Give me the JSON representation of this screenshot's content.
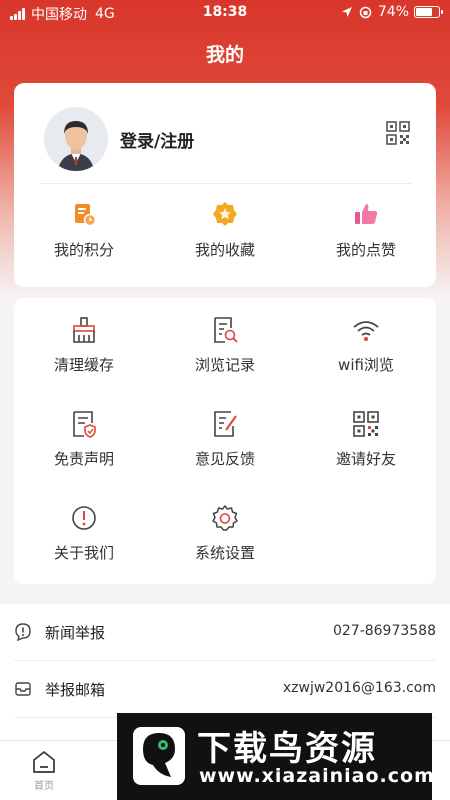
{
  "status_bar": {
    "carrier": "中国移动",
    "network": "4G",
    "time": "18:38",
    "battery": "74%",
    "battery_level": 0.74
  },
  "page": {
    "title": "我的"
  },
  "profile": {
    "login_label": "登录/注册"
  },
  "stats": [
    {
      "label": "我的积分",
      "icon": "points-icon"
    },
    {
      "label": "我的收藏",
      "icon": "star-icon"
    },
    {
      "label": "我的点赞",
      "icon": "thumbs-up-icon"
    }
  ],
  "tools": [
    {
      "label": "清理缓存",
      "icon": "broom-icon"
    },
    {
      "label": "浏览记录",
      "icon": "history-icon"
    },
    {
      "label": "wifi浏览",
      "icon": "wifi-icon"
    },
    {
      "label": "免责声明",
      "icon": "disclaimer-icon"
    },
    {
      "label": "意见反馈",
      "icon": "feedback-icon"
    },
    {
      "label": "邀请好友",
      "icon": "qr-code-icon"
    },
    {
      "label": "关于我们",
      "icon": "info-icon"
    },
    {
      "label": "系统设置",
      "icon": "gear-icon"
    }
  ],
  "report_list": [
    {
      "label": "新闻举报",
      "value": "027-86973588",
      "icon": "report-icon"
    },
    {
      "label": "举报邮箱",
      "value": "xzwjw2016@163.com",
      "icon": "mail-icon"
    }
  ],
  "tabbar": {
    "home_label": "首页"
  },
  "watermark": {
    "title": "下载鸟资源",
    "url": "www.xiazainiao.com"
  },
  "colors": {
    "brand_red": "#d9362b",
    "icon_orange": "#f28c28",
    "icon_pink": "#e9558f",
    "icon_dark": "#444444"
  }
}
